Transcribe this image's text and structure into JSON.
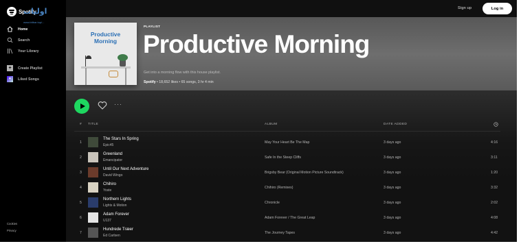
{
  "sidebar": {
    "logo_text": "Spotify",
    "watermark": {
      "text": "اوليات",
      "subtitle": "www.bitbar.top/...",
      "color": "#4a86c5"
    },
    "nav": [
      {
        "label": "Home",
        "icon": "home-icon"
      },
      {
        "label": "Search",
        "icon": "search-icon"
      },
      {
        "label": "Your Library",
        "icon": "library-icon"
      }
    ],
    "actions": [
      {
        "label": "Create Playlist",
        "icon": "plus-icon"
      },
      {
        "label": "Liked Songs",
        "icon": "heart-icon"
      }
    ],
    "footer": [
      "Cookies",
      "Privacy"
    ]
  },
  "topbar": {
    "signup_label": "Sign up",
    "login_label": "Log in"
  },
  "playlist": {
    "label": "PLAYLIST",
    "title": "Productive Morning",
    "cover_title_line1": "Productive",
    "cover_title_line2": "Morning",
    "description": "Get into a morning flow with this house playlist.",
    "owner": "Spotify",
    "meta": " • 18,652 likes • 65 songs, 3 hr 4 min"
  },
  "controls": {
    "more_label": "···"
  },
  "table": {
    "headers": {
      "num": "#",
      "title": "TITLE",
      "album": "ALBUM",
      "date": "DATE ADDED",
      "duration_icon": "clock-icon"
    },
    "rows": [
      {
        "num": "1",
        "title": "The Stars In Spring",
        "artist": "Epic45",
        "album": "May Your Heart Be The Map",
        "date": "3 days ago",
        "duration": "4:16",
        "art": "#3f4a3a"
      },
      {
        "num": "2",
        "title": "Greenland",
        "artist": "Emancipator",
        "album": "Safe In the Steep Cliffs",
        "date": "3 days ago",
        "duration": "3:11",
        "art": "#c9c4bb"
      },
      {
        "num": "3",
        "title": "Until Our Next Adventure",
        "artist": "David Wingo",
        "album": "Brigsby Bear (Original Motion Picture Soundtrack)",
        "date": "3 days ago",
        "duration": "1:20",
        "art": "#6b3b2b"
      },
      {
        "num": "4",
        "title": "Chihiro",
        "artist": "Yoste",
        "album": "Chihiro (Remixes)",
        "date": "3 days ago",
        "duration": "3:32",
        "art": "#d8d2c2"
      },
      {
        "num": "5",
        "title": "Northern Lights",
        "artist": "Lights & Motion",
        "album": "Chronicle",
        "date": "3 days ago",
        "duration": "2:02",
        "art": "#2a3c6b"
      },
      {
        "num": "6",
        "title": "Adam Forever",
        "artist": "U137",
        "album": "Adam Forever / The Great Leap",
        "date": "3 days ago",
        "duration": "4:08",
        "art": "#e4e4e4"
      },
      {
        "num": "7",
        "title": "Hundrede Træer",
        "artist": "Ed Carlsen",
        "album": "The Journey Tapes",
        "date": "3 days ago",
        "duration": "4:42",
        "art": "#555555"
      }
    ]
  },
  "colors": {
    "accent": "#1ed760",
    "sidebar_bg": "#000000",
    "main_bg": "#121212"
  }
}
